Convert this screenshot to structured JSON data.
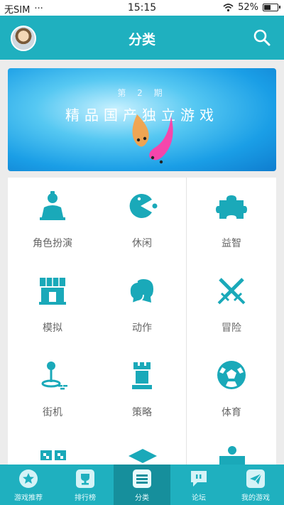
{
  "status_bar": {
    "carrier": "无SIM",
    "dots": "···",
    "time": "15:15",
    "battery": "52%",
    "battery_level": 0.52
  },
  "app_bar": {
    "title": "分类"
  },
  "banner": {
    "subtitle": "第 2 期",
    "title": "精品国产独立游戏"
  },
  "categories": [
    {
      "label": "角色扮演",
      "icon": "person-icon"
    },
    {
      "label": "休闲",
      "icon": "pacman-icon"
    },
    {
      "label": "益智",
      "icon": "puzzle-icon"
    },
    {
      "label": "模拟",
      "icon": "shop-icon"
    },
    {
      "label": "动作",
      "icon": "heads-icon"
    },
    {
      "label": "冒险",
      "icon": "crossed-swords-icon"
    },
    {
      "label": "街机",
      "icon": "joystick-icon"
    },
    {
      "label": "策略",
      "icon": "rook-icon"
    },
    {
      "label": "体育",
      "icon": "soccer-ball-icon"
    }
  ],
  "bottom_nav": [
    {
      "label": "游戏推荐",
      "icon": "star-icon",
      "active": false
    },
    {
      "label": "排行榜",
      "icon": "trophy-icon",
      "active": false
    },
    {
      "label": "分类",
      "icon": "list-icon",
      "active": true
    },
    {
      "label": "论坛",
      "icon": "chat-icon",
      "active": false
    },
    {
      "label": "我的游戏",
      "icon": "paper-plane-icon",
      "active": false
    }
  ],
  "colors": {
    "primary": "#1fb0bf",
    "nav_active": "#168f9c",
    "icon": "#1aa9b9",
    "label": "#666666"
  }
}
